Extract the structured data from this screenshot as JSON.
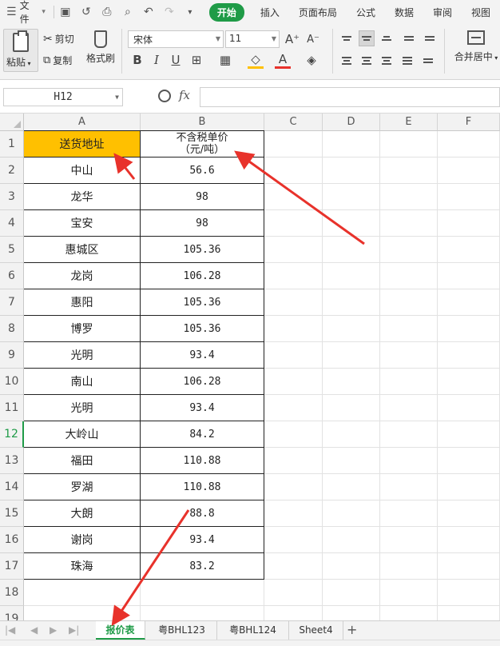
{
  "menubar": {
    "file_label": "文件",
    "tabs": [
      "开始",
      "插入",
      "页面布局",
      "公式",
      "数据",
      "审阅",
      "视图"
    ]
  },
  "ribbon": {
    "paste": "粘贴",
    "cut": "剪切",
    "copy": "复制",
    "format_painter": "格式刷",
    "font_name": "宋体",
    "font_size": "11",
    "merge_center": "合并居中"
  },
  "formula_bar": {
    "name_box": "H12",
    "fx": "fx",
    "formula": ""
  },
  "sheet": {
    "columns": [
      "A",
      "B",
      "C",
      "D",
      "E",
      "F"
    ],
    "row_numbers": [
      "1",
      "2",
      "3",
      "4",
      "5",
      "6",
      "7",
      "8",
      "9",
      "10",
      "11",
      "12",
      "13",
      "14",
      "15",
      "16",
      "17",
      "18",
      "19"
    ],
    "active_row": "12",
    "header_a": "送货地址",
    "header_b_line1": "不含税单价",
    "header_b_line2": "（元/吨）",
    "rows": [
      {
        "addr": "中山",
        "price": "56.6"
      },
      {
        "addr": "龙华",
        "price": "98"
      },
      {
        "addr": "宝安",
        "price": "98"
      },
      {
        "addr": "惠城区",
        "price": "105.36"
      },
      {
        "addr": "龙岗",
        "price": "106.28"
      },
      {
        "addr": "惠阳",
        "price": "105.36"
      },
      {
        "addr": "博罗",
        "price": "105.36"
      },
      {
        "addr": "光明",
        "price": "93.4"
      },
      {
        "addr": "南山",
        "price": "106.28"
      },
      {
        "addr": "光明",
        "price": "93.4"
      },
      {
        "addr": "大岭山",
        "price": "84.2"
      },
      {
        "addr": "福田",
        "price": "110.88"
      },
      {
        "addr": "罗湖",
        "price": "110.88"
      },
      {
        "addr": "大朗",
        "price": "88.8"
      },
      {
        "addr": "谢岗",
        "price": "93.4"
      },
      {
        "addr": "珠海",
        "price": "83.2"
      }
    ]
  },
  "sheet_tabs": [
    "报价表",
    "粤BHL123",
    "粤BHL124",
    "Sheet4"
  ],
  "colors": {
    "accent": "#1f9b47",
    "header_fill": "#ffc000",
    "arrow": "#e8322b"
  }
}
